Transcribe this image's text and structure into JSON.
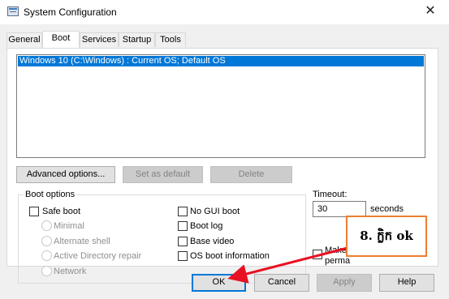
{
  "window": {
    "title": "System Configuration",
    "close_glyph": "✕"
  },
  "tabs": [
    {
      "label": "General",
      "active": false
    },
    {
      "label": "Boot",
      "active": true
    },
    {
      "label": "Services",
      "active": false
    },
    {
      "label": "Startup",
      "active": false
    },
    {
      "label": "Tools",
      "active": false
    }
  ],
  "os_list": {
    "selected_entry": "Windows 10 (C:\\Windows) : Current OS; Default OS"
  },
  "list_buttons": {
    "advanced": "Advanced options...",
    "set_default": "Set as default",
    "delete": "Delete"
  },
  "boot_options": {
    "group_label": "Boot options",
    "safe_boot": "Safe boot",
    "minimal": "Minimal",
    "alternate_shell": "Alternate shell",
    "active_directory_repair": "Active Directory repair",
    "network": "Network",
    "no_gui_boot": "No GUI boot",
    "boot_log": "Boot log",
    "base_video": "Base video",
    "os_boot_information": "OS boot information"
  },
  "timeout": {
    "label": "Timeout:",
    "value": "30",
    "unit": "seconds"
  },
  "make_permanent": {
    "line1": "Make",
    "line2": "perma"
  },
  "bottom_buttons": {
    "ok": "OK",
    "cancel": "Cancel",
    "apply": "Apply",
    "help": "Help"
  },
  "annotation": {
    "text": "8. ក្លិក ok",
    "border_color": "#ed7d31",
    "arrow_color": "#e81123"
  }
}
